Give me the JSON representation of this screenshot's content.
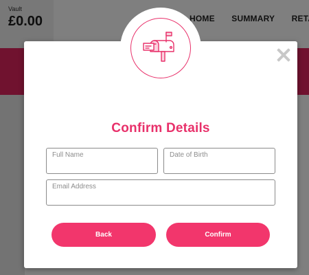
{
  "header": {
    "vault_label": "Vault",
    "vault_amount": "£0.00",
    "nav": [
      "HOME",
      "SUMMARY",
      "RETAI"
    ]
  },
  "colors": {
    "accent": "#e8306a",
    "button": "#f2366c",
    "band": "#e0245e"
  },
  "modal": {
    "icon": "mailbox-icon",
    "title": "Confirm Details",
    "fields": {
      "full_name": {
        "label": "Full Name",
        "value": ""
      },
      "dob": {
        "label": "Date of Birth",
        "value": ""
      },
      "email": {
        "label": "Email Address",
        "value": ""
      }
    },
    "back_label": "Back",
    "confirm_label": "Confirm"
  }
}
